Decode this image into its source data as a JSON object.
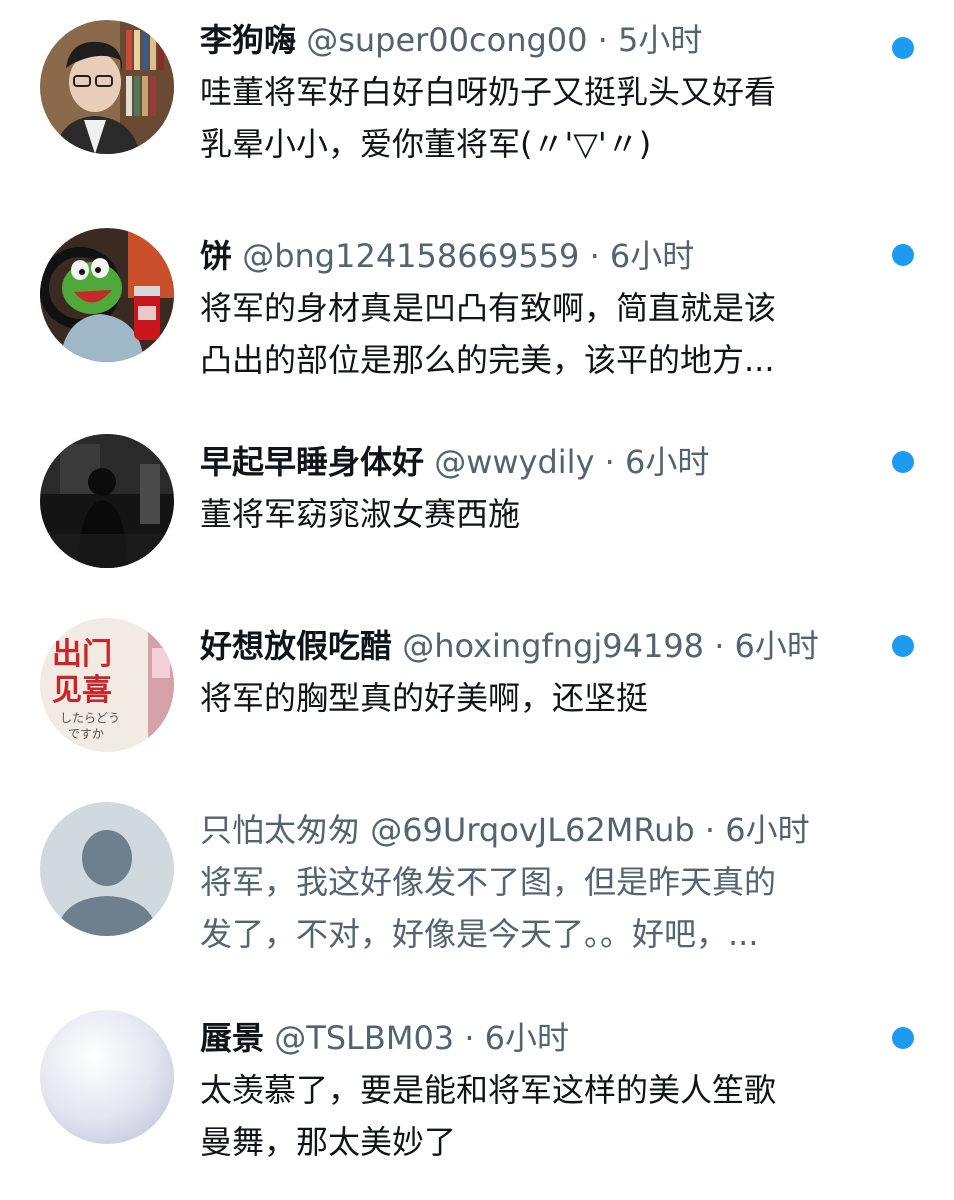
{
  "colors": {
    "unread_dot": "#1d9bf0",
    "secondary_text": "#536471",
    "primary_text": "#0f1419"
  },
  "replies": [
    {
      "name": "李狗嗨",
      "handle": "@super00cong00",
      "separator": "·",
      "time": "5小时",
      "text_lines": [
        "哇董将军好白好白呀奶子又挺乳头又好看",
        "乳晕小小，爱你董将军(〃'▽'〃)"
      ],
      "unread": true
    },
    {
      "name": "饼",
      "handle": "@bng124158669559",
      "separator": "·",
      "time": "6小时",
      "text_lines": [
        "将军的身材真是凹凸有致啊，简直就是该",
        "凸出的部位是那么的完美，该平的地方..."
      ],
      "unread": true
    },
    {
      "name": "早起早睡身体好",
      "handle": "@wwydily",
      "separator": "·",
      "time": "6小时",
      "text_lines": [
        "董将军窈窕淑女赛西施"
      ],
      "unread": true
    },
    {
      "name": "好想放假吃醋",
      "handle": "@hoxingfngj94198",
      "separator": "·",
      "time": "6小时",
      "text_lines": [
        "将军的胸型真的好美啊，还坚挺"
      ],
      "avatar_text": [
        "出门",
        "见喜",
        "したらどう",
        "ですか"
      ],
      "unread": true
    },
    {
      "name": "只怕太匆匆",
      "handle": "@69UrqovJL62MRub",
      "separator": "·",
      "time": "6小时",
      "text_lines": [
        "将军，我这好像发不了图，但是昨天真的",
        "发了，不对，好像是今天了。。好吧，..."
      ],
      "unread": false
    },
    {
      "name": "蜃景",
      "handle": "@TSLBM03",
      "separator": "·",
      "time": "6小时",
      "text_lines": [
        "太羡慕了，要是能和将军这样的美人笙歌",
        "曼舞，那太美妙了"
      ],
      "unread": true
    }
  ]
}
